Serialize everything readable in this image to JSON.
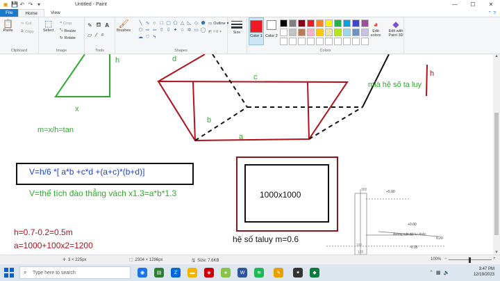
{
  "window": {
    "title": "Untitled - Paint"
  },
  "tabs": [
    "File",
    "Home",
    "View"
  ],
  "ribbon": {
    "clipboard": {
      "paste": "Paste",
      "cut": "Cut",
      "copy": "Copy",
      "label": "Clipboard"
    },
    "image": {
      "select": "Select",
      "crop": "Crop",
      "resize": "Resize",
      "rotate": "Rotate",
      "label": "Image"
    },
    "tools": {
      "label": "Tools"
    },
    "brushes": "Brushes",
    "shapes": {
      "outline": "Outline",
      "fill": "Fill",
      "label": "Shapes"
    },
    "size": "Size",
    "color1": "Color 1",
    "color2": "Color 2",
    "colors_label": "Colors",
    "edit_colors": "Edit colors",
    "edit_3d": "Edit with Paint 3D",
    "palette": [
      "#000000",
      "#7f7f7f",
      "#880015",
      "#ed1c24",
      "#ff7f27",
      "#fff200",
      "#22b14c",
      "#00a2e8",
      "#3f48cc",
      "#a349a4",
      "#ffffff",
      "#c3c3c3",
      "#b97a57",
      "#ffaec9",
      "#ffc90e",
      "#efe4b0",
      "#b5e61d",
      "#99d9ea",
      "#7092be",
      "#c8bfe7",
      "#ffffff",
      "#ffffff",
      "#ffffff",
      "#ffffff",
      "#ffffff",
      "#ffffff",
      "#ffffff",
      "#ffffff",
      "#ffffff",
      "#ffffff"
    ],
    "color1_value": "#ed1c24",
    "color2_value": "#ffffff"
  },
  "canvas": {
    "labels": {
      "h_left": "h",
      "x": "x",
      "m_formula": "m=x/h=tan",
      "d": "d",
      "c": "c",
      "b": "b",
      "a": "a",
      "h_right": "h",
      "mia": "mià hệ số ta luy",
      "v_formula": "V=h/6 *[ a*b +c*d +(a+c)*(b+d)]",
      "v_wall": "V=thể tích đào thẳng vách x1.3=a*b*1.3",
      "h_calc": "h=0.7-0.2=0.5m",
      "a_calc": "a=1000+100x2=1200",
      "box_size": "1000x1000",
      "taluy": "hệ số taluy m=0.6",
      "sec_300": "300",
      "sec_p500": "+5.00",
      "sec_p000": "+0.00",
      "sec_natural": "đường mặt đất tự nhiên",
      "sec_020": "0.20",
      "sec_035": "-0.35",
      "sec_100": "100",
      "sec_120": "120"
    }
  },
  "status": {
    "cursor": "3 × 225px",
    "dimensions": "2304 × 1296px",
    "size": "Size: 7.6KB",
    "zoom": "100%"
  },
  "taskbar": {
    "search_placeholder": "Type here to search",
    "time": "3:47 PM",
    "date": "12/19/2023"
  }
}
